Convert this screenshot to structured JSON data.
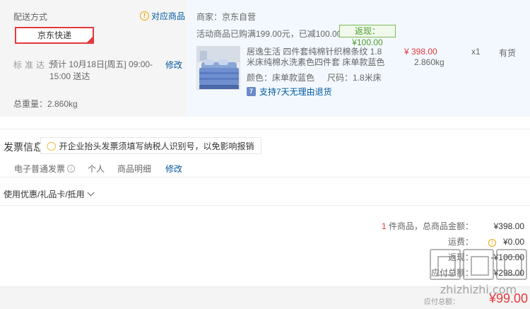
{
  "delivery": {
    "title": "配送方式",
    "match_link": "对应商品",
    "method": "京东快递",
    "standard_label": "标准达：",
    "standard_value": "预计 10月18日[周五] 09:00-15:00 送达",
    "standard_edit": "修改",
    "total_weight": "总重量：2.860kg"
  },
  "shop": {
    "seller": "商家：京东自营",
    "promo_text": "活动商品已购满199.00元，已减100.00元现金",
    "promo_badge": "返现：¥100.00"
  },
  "product": {
    "name": "居逸生活 四件套纯棉针织棉条纹 1.8米床纯棉水洗素色四件套 床单款蓝色",
    "color": "颜色：床单款蓝色",
    "size": "尺码：1.8米床",
    "price": "¥ 398.00",
    "weight": "2.860kg",
    "qty": "x1",
    "stock": "有货",
    "return_note": "支持7天无理由退货",
    "return_icon": "7"
  },
  "invoice": {
    "title": "发票信息",
    "tip": "开企业抬头发票须填写纳税人识别号，以免影响报销",
    "type": "电子普通发票",
    "holder": "个人",
    "content": "商品明细",
    "edit": "修改"
  },
  "coupon": {
    "label": "使用优惠/礼品卡/抵用"
  },
  "summary": {
    "count": "1",
    "count_label": "件商品，总商品金额：",
    "goods_amount": "¥398.00",
    "freight_label": "运费：",
    "freight": "¥0.00",
    "rebate_label": "返现：",
    "rebate": "-¥100.00",
    "payable_label": "应付总额：",
    "payable": "¥298.00",
    "pay_label": "应付总额：",
    "pay_amount": "¥99.00"
  },
  "watermark": {
    "text": "zhizhizhi.com"
  },
  "colors": {
    "accent": "#e4393c",
    "link": "#005aa0",
    "promo_green": "#4d9b2c",
    "warning": "#f0a000"
  }
}
